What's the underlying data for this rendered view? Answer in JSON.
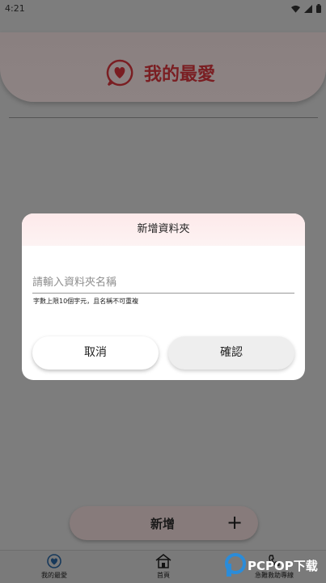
{
  "status": {
    "time": "4:21"
  },
  "header": {
    "title": "我的最愛"
  },
  "dialog": {
    "title": "新增資料夾",
    "input_placeholder": "請輸入資料夾名稱",
    "input_value": "",
    "hint": "字數上限10個字元，且名稱不可重複",
    "cancel_label": "取消",
    "confirm_label": "確認"
  },
  "add_bar": {
    "label": "新增",
    "plus": "+"
  },
  "nav": {
    "items": [
      {
        "label": "我的最愛",
        "icon": "heart-icon"
      },
      {
        "label": "首頁",
        "icon": "home-icon"
      },
      {
        "label": "急難救助專線",
        "icon": "phone-icon"
      }
    ]
  },
  "watermark": {
    "text": "PCPOP下载"
  },
  "colors": {
    "accent": "#7a1e22",
    "dialog_header": "#fde9ea",
    "nav_heart": "#17395b"
  }
}
